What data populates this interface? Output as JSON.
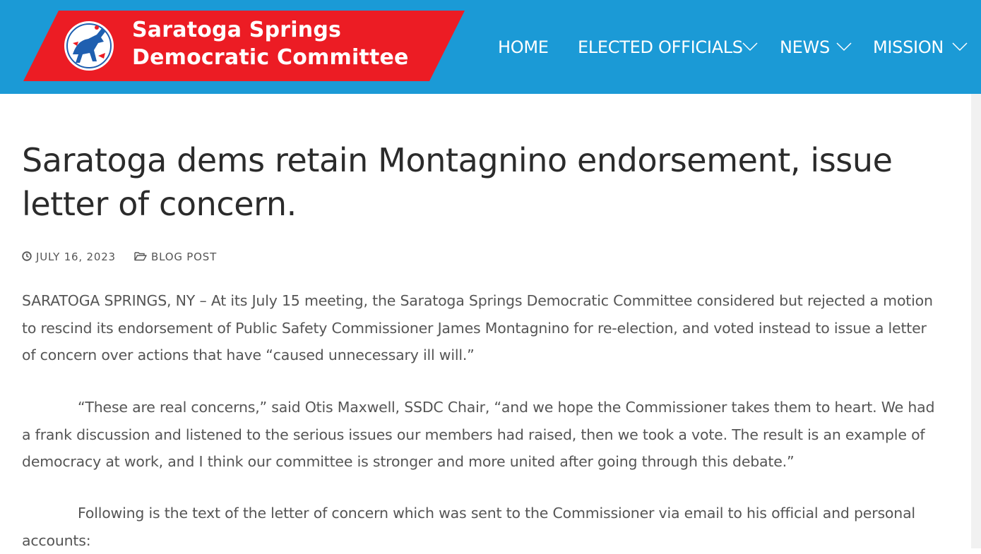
{
  "header": {
    "logo": {
      "line1": "Saratoga Springs",
      "line2": "Democratic Committee",
      "icon": "democratic-donkey-icon"
    },
    "nav": [
      {
        "label": "HOME",
        "has_dropdown": false
      },
      {
        "label": "ELECTED OFFICIALS",
        "has_dropdown": true
      },
      {
        "label": "NEWS",
        "has_dropdown": true
      },
      {
        "label": "MISSION",
        "has_dropdown": true
      }
    ]
  },
  "article": {
    "title": "Saratoga dems retain Montagnino endorsement, issue letter of concern.",
    "date": "JULY 16, 2023",
    "date_icon": "clock-icon",
    "category": "BLOG POST",
    "category_icon": "folder-open-icon",
    "paragraphs": [
      "SARATOGA SPRINGS, NY – At its July 15 meeting, the Saratoga Springs Democratic Committee considered but rejected a motion to rescind its endorsement of Public Safety Commissioner James Montagnino for re-election, and voted instead to issue a letter of concern over actions that have “caused unnecessary ill will.”",
      "“These are real concerns,” said Otis Maxwell, SSDC Chair, “and we hope the Commissioner takes them to heart. We had a frank discussion and listened to the serious issues our members had raised, then we took a vote. The result is an example of democracy at work, and I think our committee is stronger and more united after going through this debate.”",
      "Following is the text of the letter of concern which was sent to the Commissioner via email to his official and personal accounts:"
    ]
  },
  "colors": {
    "header_bg": "#1b9ad6",
    "logo_banner": "#ec1c24",
    "text": "#555555",
    "title": "#2b2b2b"
  }
}
